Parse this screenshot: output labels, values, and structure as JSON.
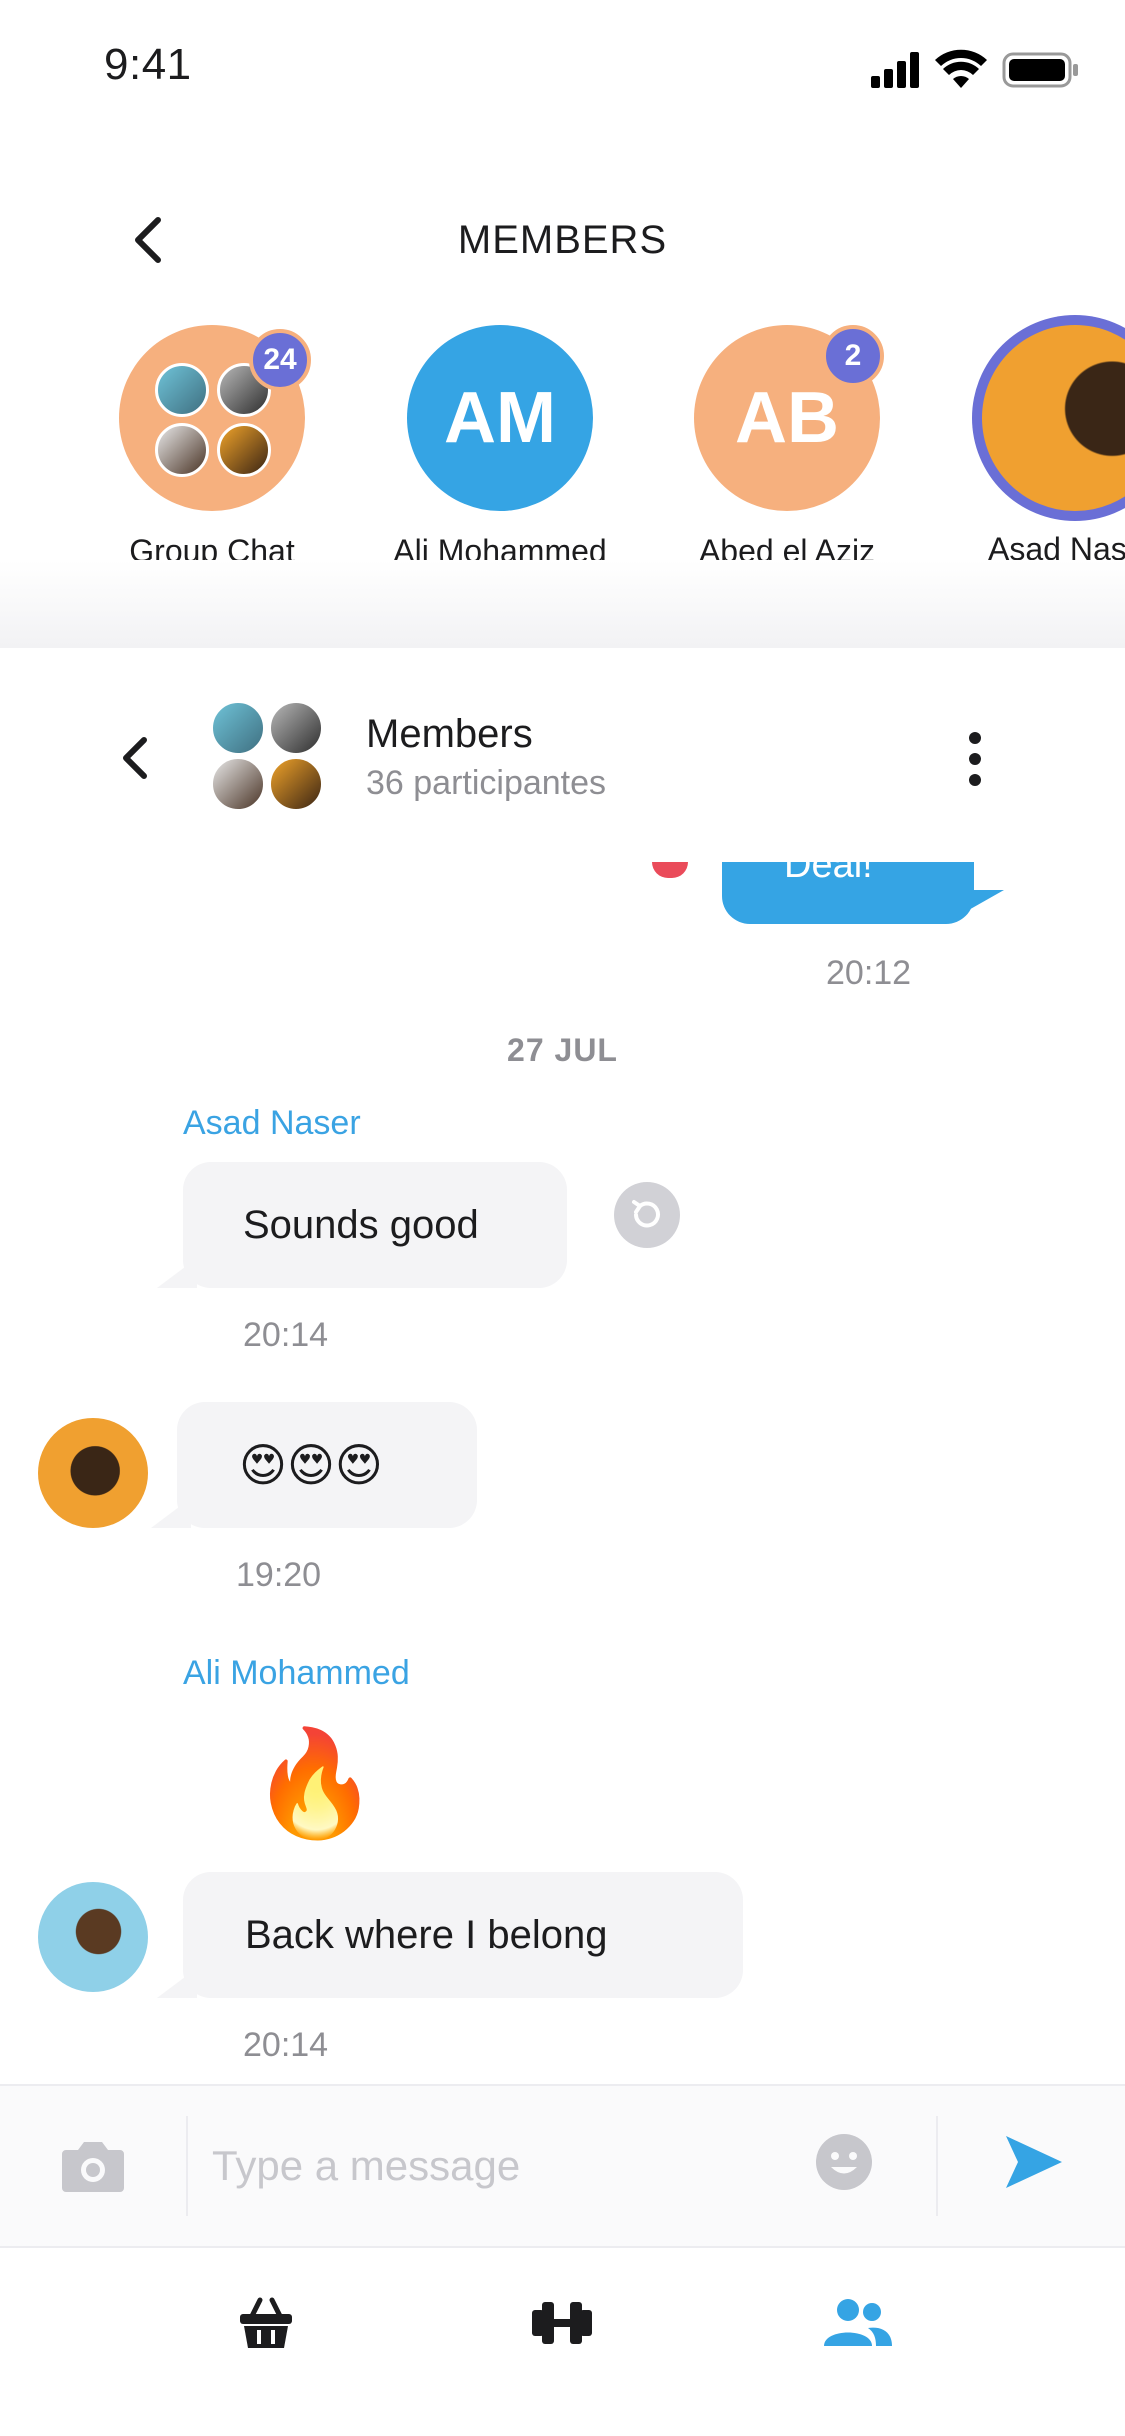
{
  "status_bar": {
    "time": "9:41"
  },
  "members_panel": {
    "title": "MEMBERS",
    "members": [
      {
        "name": "Group Chat",
        "initials": "",
        "badge": "24",
        "color": "#f6b07e"
      },
      {
        "name": "Ali Mohammed",
        "initials": "AM",
        "badge": "",
        "color": "#35a4e4"
      },
      {
        "name": "Abed el Aziz",
        "initials": "AB",
        "badge": "2",
        "color": "#f6b07e"
      },
      {
        "name": "Asad Naser",
        "initials": "",
        "badge": "",
        "color": "#6a6fd6"
      }
    ]
  },
  "chat_header": {
    "title": "Members",
    "subtitle": "36 participantes"
  },
  "messages": {
    "outgoing_partial": {
      "text": "Deal!",
      "time": "20:12"
    },
    "date_divider": "27 JUL",
    "msg1": {
      "sender": "Asad Naser",
      "text": "Sounds good",
      "time": "20:14"
    },
    "msg2": {
      "text": "😍😍😍",
      "time": "19:20"
    },
    "msg3": {
      "sender": "Ali Mohammed",
      "emoji": "🔥",
      "text": "Back where I belong",
      "time": "20:14"
    }
  },
  "composer": {
    "placeholder": "Type a message"
  },
  "colors": {
    "accent": "#35a4e4",
    "peach": "#f6b07e",
    "badge": "#6a6fd6",
    "bubble": "#f4f4f6",
    "muted": "#8e8e93"
  },
  "icons": {
    "status": [
      "signal-icon",
      "wifi-icon",
      "battery-icon"
    ],
    "tabs": [
      "basket-icon",
      "dumbbell-icon",
      "people-icon"
    ],
    "composer": [
      "camera-icon",
      "emoji-icon",
      "send-icon"
    ]
  }
}
